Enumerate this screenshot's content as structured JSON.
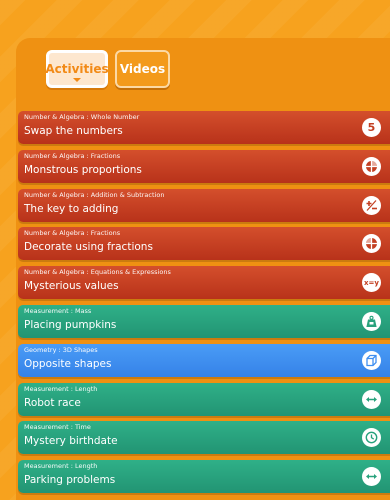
{
  "tabs": {
    "activities_label": "Activities",
    "videos_label": "Videos"
  },
  "colors": {
    "background": "#f7a21e",
    "red_card": "#c33f22",
    "green_card": "#28a27d",
    "blue_card": "#3f8ff0"
  },
  "activities": [
    {
      "category": "Number & Algebra : Whole Number",
      "title": "Swap the numbers",
      "theme": "red",
      "icon": "number-five-icon",
      "glyph": "5"
    },
    {
      "category": "Number & Algebra : Fractions",
      "title": "Monstrous proportions",
      "theme": "red",
      "icon": "fraction-circle-icon"
    },
    {
      "category": "Number & Algebra : Addition & Subtraction",
      "title": "The key to adding",
      "theme": "red",
      "icon": "plus-minus-icon"
    },
    {
      "category": "Number & Algebra : Fractions",
      "title": "Decorate using fractions",
      "theme": "red",
      "icon": "fraction-circle-icon"
    },
    {
      "category": "Number & Algebra : Equations & Expressions",
      "title": "Mysterious values",
      "theme": "red",
      "icon": "equation-icon",
      "glyph": "x=y"
    },
    {
      "category": "Measurement : Mass",
      "title": "Placing pumpkins",
      "theme": "green",
      "icon": "weight-icon"
    },
    {
      "category": "Geometry : 3D Shapes",
      "title": "Opposite shapes",
      "theme": "blue",
      "icon": "cube-icon"
    },
    {
      "category": "Measurement : Length",
      "title": "Robot race",
      "theme": "green",
      "icon": "ruler-arrow-icon"
    },
    {
      "category": "Measurement : Time",
      "title": "Mystery birthdate",
      "theme": "green",
      "icon": "clock-icon"
    },
    {
      "category": "Measurement : Length",
      "title": "Parking problems",
      "theme": "green",
      "icon": "ruler-arrow-icon"
    }
  ]
}
